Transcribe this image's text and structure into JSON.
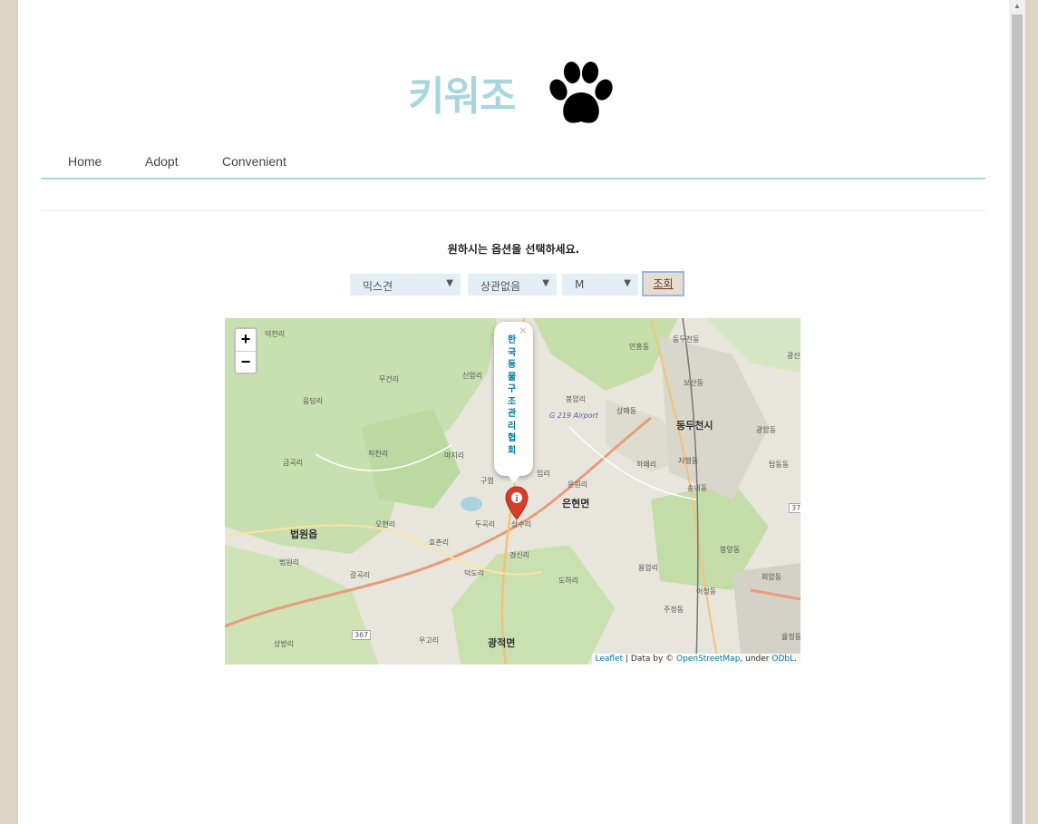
{
  "logo": {
    "text": "키워조",
    "icon": "paw-icon"
  },
  "nav": {
    "items": [
      "Home",
      "Adopt",
      "Convenient"
    ]
  },
  "prompt": "원하시는 옵션을 선택하세요.",
  "selects": [
    {
      "value": "믹스견"
    },
    {
      "value": "상관없음"
    },
    {
      "value": "M"
    }
  ],
  "search_button": "조회",
  "map": {
    "popup_text": "한국동물구조관리협회",
    "attribution": {
      "leaflet": "Leaflet",
      "mid": " | Data by © ",
      "osm": "OpenStreetMap",
      "under": ", under ",
      "odbl": "ODbL",
      "end": "."
    },
    "labels": {
      "l1": "덕천리",
      "l2": "무건리",
      "l3": "신암리",
      "l4": "봉암리",
      "l5": "상패동",
      "l6": "동두천시",
      "l7": "직천리",
      "l8": "마지리",
      "l9": "금곡리",
      "l10": "은현면",
      "l11": "법원읍",
      "l12": "오현리",
      "l13": "두곡리",
      "l14": "상수리",
      "l15": "경신리",
      "l16": "효촌리",
      "l17": "법원리",
      "l18": "갈곡리",
      "l19": "덕도리",
      "l20": "도하리",
      "l21": "광적면",
      "l22": "우고리",
      "l23": "상방리",
      "l24": "봉양동",
      "l25": "용암리",
      "l26": "하패리",
      "l27": "송내동",
      "l28": "광암동",
      "l29": "탑동동",
      "l30": "G 219 Airport",
      "l31": "367",
      "l32": "37",
      "l33": "안흥동",
      "l34": "동두천동",
      "l35": "회암동",
      "l36": "어정동",
      "l37": "지행동",
      "l38": "운원리",
      "l39": "광산",
      "l40": "율정동",
      "l41": "주정동",
      "l42": "웅담리",
      "l43": "구엽",
      "l44": "임리",
      "l45": "보산동"
    }
  },
  "colors": {
    "logo": "#a9d6dd",
    "nav_line": "#a5d7dc",
    "select_bg": "#e4eef6",
    "button_bg": "#e6ddd0",
    "marker": "#d63e2a",
    "link": "#0078a8"
  }
}
